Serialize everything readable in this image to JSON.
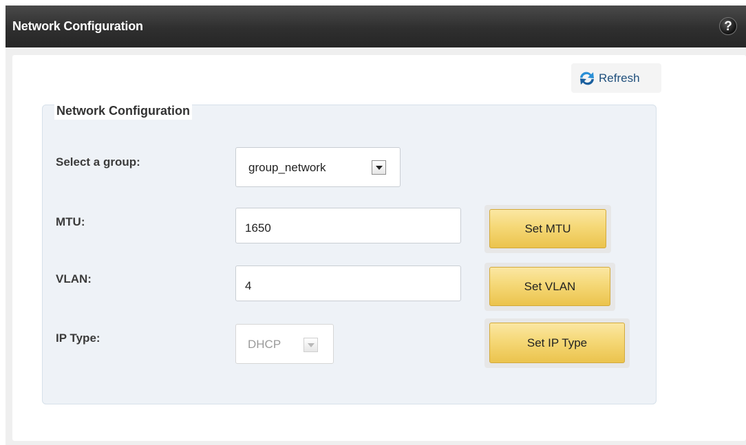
{
  "header": {
    "title": "Network Configuration",
    "help_glyph": "?"
  },
  "toolbar": {
    "refresh_label": "Refresh",
    "refresh_icon": "refresh-icon"
  },
  "form": {
    "legend": "Network Configuration",
    "group": {
      "label": "Select a group:",
      "value": "group_network"
    },
    "mtu": {
      "label": "MTU:",
      "value": "1650",
      "button_label": "Set MTU"
    },
    "vlan": {
      "label": "VLAN:",
      "value": "4",
      "button_label": "Set VLAN"
    },
    "ip_type": {
      "label": "IP Type:",
      "value": "DHCP",
      "button_label": "Set IP Type",
      "disabled": true
    }
  },
  "colors": {
    "header_bg": "#2f2f2f",
    "button_gold": "#f5d877",
    "panel_bg": "#eef2f7",
    "link_blue": "#1f4f7c"
  }
}
